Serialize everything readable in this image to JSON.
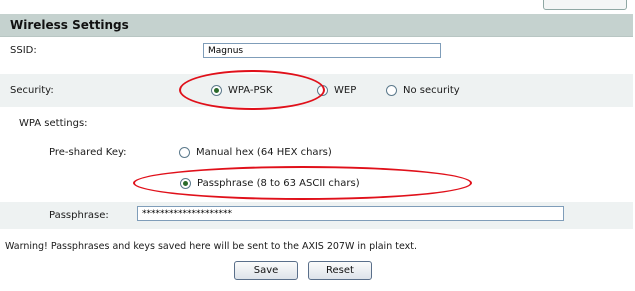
{
  "header": {
    "title": "Wireless Settings"
  },
  "ssid": {
    "label": "SSID:",
    "value": "Magnus"
  },
  "security": {
    "label": "Security:",
    "options": [
      "WPA-PSK",
      "WEP",
      "No security"
    ],
    "selected": "WPA-PSK"
  },
  "wpa": {
    "section_label": "WPA settings:",
    "psk_label": "Pre-shared Key:",
    "options": [
      "Manual hex (64 HEX chars)",
      "Passphrase (8 to 63 ASCII chars)"
    ],
    "selected": "Passphrase (8 to 63 ASCII chars)"
  },
  "passphrase": {
    "label": "Passphrase:",
    "value": "********************"
  },
  "warning": "Warning! Passphrases and keys saved here will be sent to the AXIS 207W in plain text.",
  "buttons": {
    "save": "Save",
    "reset": "Reset"
  },
  "colors": {
    "header_bg": "#c5d2cf",
    "row_shade": "#eef2f2",
    "highlight": "#e0101a"
  }
}
